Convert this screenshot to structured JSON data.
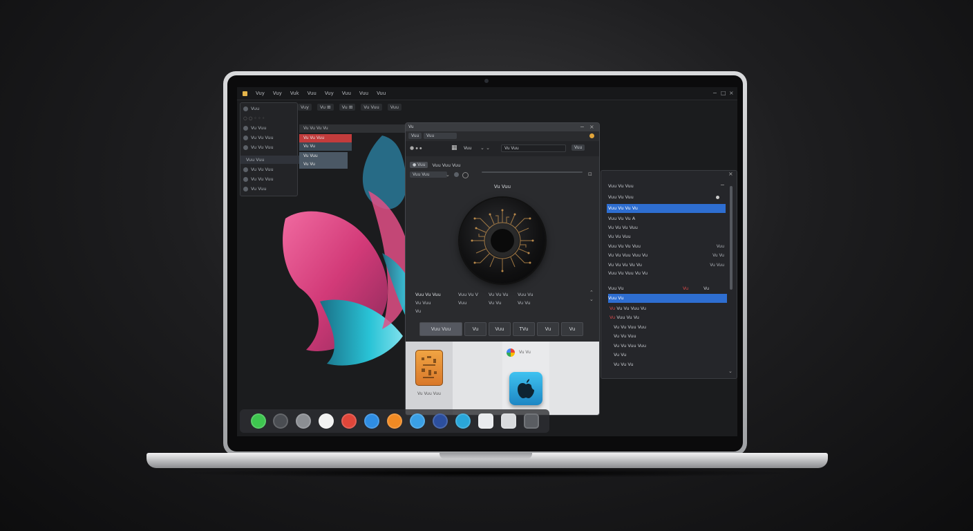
{
  "menubar": {
    "app_icon": "app-logo-icon",
    "items": [
      "Vuy",
      "Vuy",
      "Vuk",
      "Vuu",
      "Vuy",
      "Vuu",
      "Vuu",
      "Vuu"
    ],
    "controls": [
      "−",
      "□",
      "×"
    ]
  },
  "toolbar": {
    "items": [
      "Vuy",
      "Vu ⊞",
      "Vu ⊞",
      "Vu Vuu",
      "Vuu"
    ]
  },
  "left_panel": {
    "header": "Vuu",
    "rows": [
      "Vu Vuu",
      "Vu Vu Vuu",
      "Vu Vu Vuu",
      "Vuu Vuu",
      "Vu Vu Vuu",
      "Vu Vu Vuu",
      "Vu Vuu"
    ]
  },
  "tracks": {
    "header": "Vu Vu Vu Vu",
    "rows": [
      "Vu Vu Vuu",
      "Vu Vu",
      "Vu Vuu",
      "Vu Vu"
    ]
  },
  "center_window": {
    "title": "Vu",
    "tabs": [
      "Vuu",
      "Vuu"
    ],
    "toolbar": [
      "Vuu",
      "Vu Vuu",
      "Vuu"
    ],
    "section": "Vuu Vuu Vuu",
    "field_value": "Vuu Vuu",
    "orb_label": "Vu Vuu",
    "stats": [
      {
        "head": "Vuu Vu Vuu",
        "lines": [
          "Vu Vuu",
          "Vu"
        ]
      },
      {
        "head": "Vuu Vu V",
        "lines": [
          "Vuu"
        ]
      },
      {
        "head": "Vu Vu Vu",
        "lines": [
          "Vu Vu"
        ]
      },
      {
        "head": "Vuu Vu",
        "lines": [
          "Vu Vu"
        ]
      }
    ],
    "segments": [
      "Vuu Vuu",
      "Vu",
      "Vuu",
      "TVu",
      "Vu",
      "Vu"
    ],
    "bottom": {
      "app1_caption": "Vu Vuu Vuu",
      "app2_caption": "Vu Vu"
    }
  },
  "right_window": {
    "title": "Vuu Vu Vuu",
    "rows": [
      {
        "label": "Vuu Vu Vuu",
        "selected": false
      },
      {
        "label": "Vuu Vu Vu Vu",
        "selected": true
      },
      {
        "label": "Vuu Vu Vu A",
        "selected": false
      },
      {
        "label": "Vu Vu Vu Vuu",
        "selected": false
      },
      {
        "label": "Vu Vu Vuu",
        "selected": false
      },
      {
        "label": "Vuu Vu Vu Vuu",
        "value": "Vuu",
        "selected": false
      },
      {
        "label": "Vu Vu Vuu Vuu Vu",
        "value": "Vu Vu",
        "selected": false
      },
      {
        "label": "Vu Vu Vu Vu Vu",
        "value": "Vu Vuu",
        "selected": false
      },
      {
        "label": "Vuu Vu Vuu Vu Vu",
        "selected": false
      }
    ],
    "group_label": "Vuu Vu",
    "group_values": [
      "Vu",
      "Vu"
    ],
    "selected_group": "Vuu Vu",
    "list": [
      "Vu Vu Vuu Vu",
      "Vuu Vu Vu",
      "Vu Vu Vuu Vuu",
      "Vu Vu Vuu",
      "Vu Vu Vuu Vuu",
      "Vu Vu",
      "Vu Vu Vu"
    ]
  },
  "dock": {
    "icons": [
      {
        "name": "messages-icon",
        "color": "#3ec64f"
      },
      {
        "name": "finder-icon",
        "color": "#4a4d52"
      },
      {
        "name": "disk-icon",
        "color": "#8b8e93"
      },
      {
        "name": "browser-icon",
        "color": "#f2f2f2"
      },
      {
        "name": "antenna-icon",
        "color": "#e0463a"
      },
      {
        "name": "safari-icon",
        "color": "#2f8de3"
      },
      {
        "name": "music-icon",
        "color": "#f08a24"
      },
      {
        "name": "photo-icon",
        "color": "#3aa0e6"
      },
      {
        "name": "mail-icon",
        "color": "#2c4f9e"
      },
      {
        "name": "chat-icon",
        "color": "#2aa6d9"
      },
      {
        "name": "notes-icon",
        "color": "#e9ebee"
      },
      {
        "name": "calendar-icon",
        "color": "#d8dadd"
      },
      {
        "name": "cloud-icon",
        "color": "#5a5d62"
      }
    ]
  },
  "colors": {
    "accent": "#2e6ed1",
    "pink": "#e8467f",
    "teal": "#1fb2c9"
  }
}
